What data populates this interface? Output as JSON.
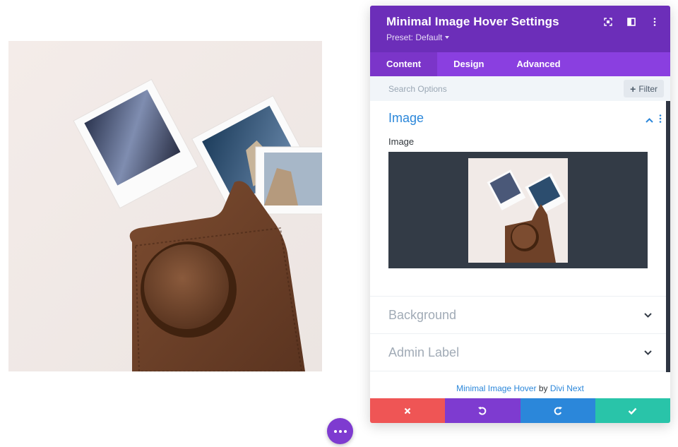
{
  "panel": {
    "title": "Minimal Image Hover Settings",
    "preset": "Preset: Default",
    "header_icons": [
      "focus-icon",
      "split-view-icon",
      "more-vertical-icon"
    ]
  },
  "tabs": [
    {
      "label": "Content",
      "active": true
    },
    {
      "label": "Design",
      "active": false
    },
    {
      "label": "Advanced",
      "active": false
    }
  ],
  "search": {
    "placeholder": "Search Options"
  },
  "filter": {
    "label": "Filter"
  },
  "sections": {
    "image": {
      "title": "Image",
      "field_label": "Image"
    },
    "background": {
      "title": "Background"
    },
    "admin_label": {
      "title": "Admin Label"
    }
  },
  "credit": {
    "plugin": "Minimal Image Hover",
    "by": "by",
    "author": "Divi Next"
  },
  "actions": [
    "close-icon",
    "undo-icon",
    "redo-icon",
    "check-icon"
  ],
  "colors": {
    "header": "#6c2eb9",
    "tabs": "#8a3fe0",
    "accent_blue": "#2b87da",
    "cancel": "#ef5555",
    "undo": "#7e3bd0",
    "redo": "#2b87da",
    "save": "#29c4a9"
  }
}
